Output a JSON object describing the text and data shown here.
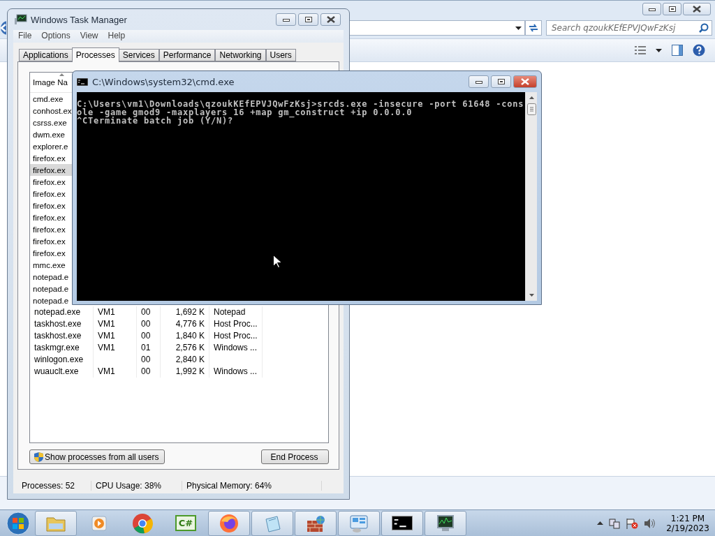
{
  "explorer": {
    "search": {
      "placeholder": "Search qzoukKEfEPVJQwFzKsj"
    }
  },
  "task_manager": {
    "title": "Windows Task Manager",
    "menu": [
      "File",
      "Options",
      "View",
      "Help"
    ],
    "tabs": [
      {
        "label": "Applications",
        "selected": false
      },
      {
        "label": "Processes",
        "selected": true
      },
      {
        "label": "Services",
        "selected": false
      },
      {
        "label": "Performance",
        "selected": false
      },
      {
        "label": "Networking",
        "selected": false
      },
      {
        "label": "Users",
        "selected": false
      }
    ],
    "columns": [
      "Image Na"
    ],
    "processes": [
      {
        "name": "cmd.exe",
        "selected": false
      },
      {
        "name": "conhost.ex",
        "selected": false
      },
      {
        "name": "csrss.exe",
        "selected": false
      },
      {
        "name": "dwm.exe",
        "selected": false
      },
      {
        "name": "explorer.e",
        "selected": false
      },
      {
        "name": "firefox.ex",
        "selected": false
      },
      {
        "name": "firefox.ex",
        "selected": true
      },
      {
        "name": "firefox.ex",
        "selected": false
      },
      {
        "name": "firefox.ex",
        "selected": false
      },
      {
        "name": "firefox.ex",
        "selected": false
      },
      {
        "name": "firefox.ex",
        "selected": false
      },
      {
        "name": "firefox.ex",
        "selected": false
      },
      {
        "name": "firefox.ex",
        "selected": false
      },
      {
        "name": "firefox.ex",
        "selected": false
      },
      {
        "name": "mmc.exe",
        "selected": false
      },
      {
        "name": "notepad.e",
        "selected": false
      },
      {
        "name": "notepad.e",
        "selected": false
      },
      {
        "name": "notepad.e",
        "selected": false
      },
      {
        "name": "notepad.exe",
        "user": "VM1",
        "cpu": "00",
        "memory": "1,692 K",
        "description": "Notepad",
        "selected": false
      },
      {
        "name": "taskhost.exe",
        "user": "VM1",
        "cpu": "00",
        "memory": "4,776 K",
        "description": "Host Proc...",
        "selected": false
      },
      {
        "name": "taskhost.exe",
        "user": "VM1",
        "cpu": "00",
        "memory": "1,840 K",
        "description": "Host Proc...",
        "selected": false
      },
      {
        "name": "taskmgr.exe",
        "user": "VM1",
        "cpu": "01",
        "memory": "2,576 K",
        "description": "Windows ...",
        "selected": false
      },
      {
        "name": "winlogon.exe",
        "cpu": "00",
        "memory": "2,840 K",
        "selected": false
      },
      {
        "name": "wuauclt.exe",
        "user": "VM1",
        "cpu": "00",
        "memory": "1,992 K",
        "description": "Windows ...",
        "selected": false
      }
    ],
    "show_all_button": "Show processes from all users",
    "end_button": "End Process",
    "status_bar": [
      "Processes: 52",
      "CPU Usage: 38%",
      "Physical Memory: 64%"
    ]
  },
  "console": {
    "title": "C:\\Windows\\system32\\cmd.exe",
    "lines": [
      "C:\\Users\\vm1\\Downloads\\qzoukKEfEPVJQwFzKsj>srcds.exe -insecure -port 61648 -cons",
      "ole -game gmod9 -maxplayers 16 +map gm_construct +ip 0.0.0.0",
      "^CTerminate batch job (Y/N)?"
    ]
  },
  "taskbar": {
    "items": [
      {
        "kind": "folder",
        "running": true
      },
      {
        "kind": "media",
        "running": false
      },
      {
        "kind": "chrome",
        "running": false
      },
      {
        "kind": "csharp",
        "label": "C#",
        "running": false
      },
      {
        "kind": "firefox",
        "running": true
      },
      {
        "kind": "notepad",
        "running": true
      },
      {
        "kind": "firewall",
        "running": true
      },
      {
        "kind": "control",
        "running": true
      },
      {
        "kind": "console",
        "running": true
      },
      {
        "kind": "monitor",
        "running": true
      }
    ],
    "clock": {
      "time": "1:21 PM",
      "date": "2/19/2023"
    }
  }
}
